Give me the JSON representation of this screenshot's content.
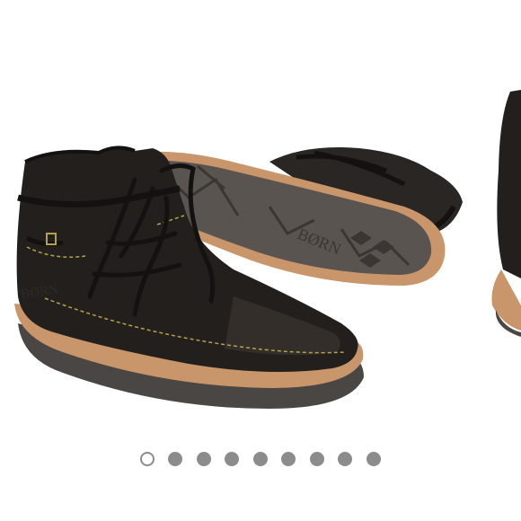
{
  "product_image": {
    "subject": "boots",
    "brand_mark": "BØRN",
    "colors": {
      "leather": "#231f1c",
      "sole": "#c9956b",
      "tread": "#4a4643",
      "stitch": "#b3a24a"
    }
  },
  "pagination": {
    "total": 9,
    "active_index": 0,
    "dot_color": "#8c8c8c"
  }
}
